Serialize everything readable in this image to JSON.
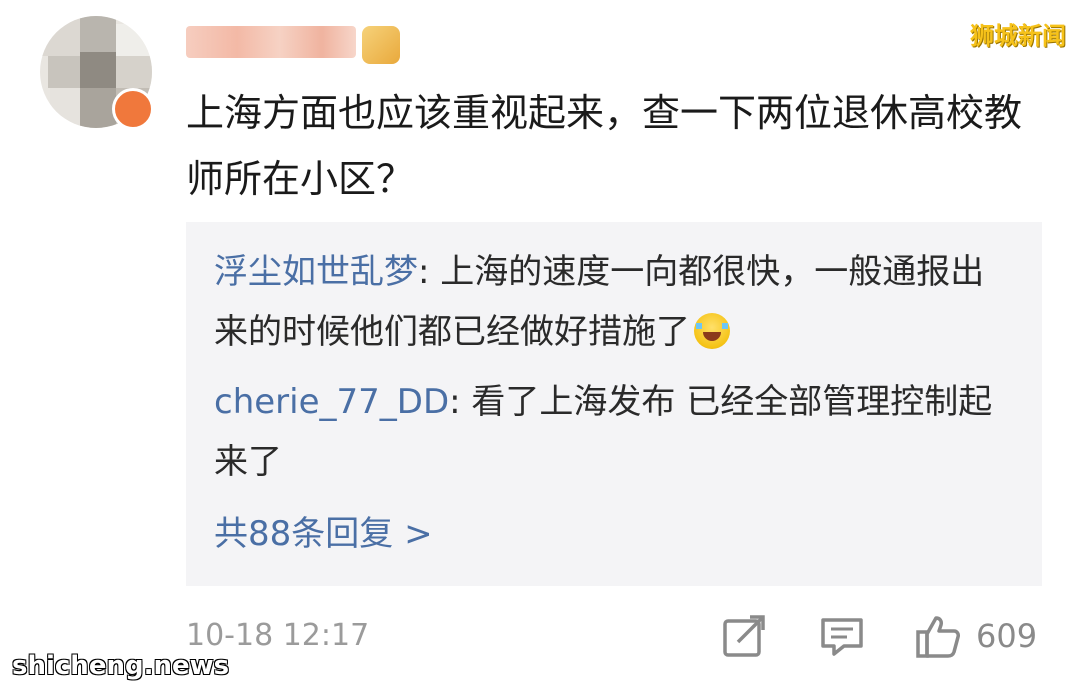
{
  "watermark": {
    "top_right": "狮城新闻",
    "bottom_left": "shicheng.news"
  },
  "comment": {
    "text": "上海方面也应该重视起来，查一下两位退休高校教师所在小区？",
    "time": "10-18 12:17",
    "likes": "609"
  },
  "replies": [
    {
      "user": "浮尘如世乱梦",
      "separator": ": ",
      "text": "上海的速度一向都很快，一般通报出来的时候他们都已经做好措施了"
    },
    {
      "user": "cherie_77_DD",
      "separator": ": ",
      "text": "看了上海发布 已经全部管理控制起来了"
    }
  ],
  "reply_summary": "共88条回复 >",
  "icons": {
    "avatar": "blurred-avatar",
    "share": "share-icon",
    "comment": "comment-icon",
    "like": "thumbs-up-icon",
    "emoji": "laugh-cry-emoji"
  },
  "colors": {
    "link_blue": "#4a6fa5",
    "meta_gray": "#9b9b9b",
    "reply_bg": "#f4f4f6",
    "watermark_yellow": "#f6c21a"
  }
}
